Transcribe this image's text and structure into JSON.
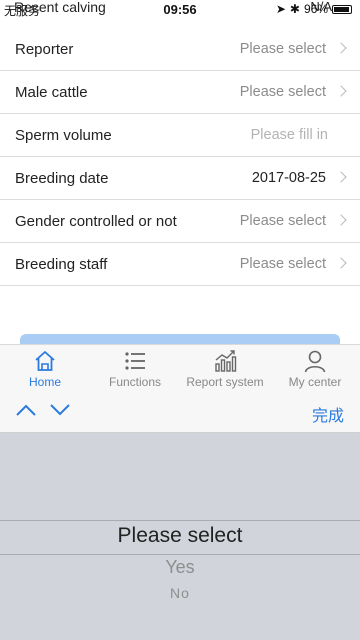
{
  "status_bar": {
    "carrier": "无服务",
    "title_overlap": "Recent calving",
    "time": "09:56",
    "na": "N/A",
    "battery": "96%"
  },
  "form": {
    "rows": [
      {
        "label": "Reporter",
        "value": "Please select",
        "kind": "select"
      },
      {
        "label": "Male cattle",
        "value": "Please select",
        "kind": "select"
      },
      {
        "label": "Sperm volume",
        "value": "Please fill in",
        "kind": "input"
      },
      {
        "label": "Breeding date",
        "value": "2017-08-25",
        "kind": "filled"
      },
      {
        "label": "Gender controlled or not",
        "value": "Please select",
        "kind": "select"
      },
      {
        "label": "Breeding staff",
        "value": "Please select",
        "kind": "select"
      }
    ]
  },
  "tabs": [
    {
      "label": "Home",
      "icon": "home-icon",
      "active": true
    },
    {
      "label": "Functions",
      "icon": "list-icon",
      "active": false
    },
    {
      "label": "Report system",
      "icon": "chart-icon",
      "active": false
    },
    {
      "label": "My center",
      "icon": "user-icon",
      "active": false
    }
  ],
  "picker": {
    "done_label": "完成",
    "options": [
      "Please select",
      "Yes",
      "No"
    ],
    "selected": "Please select"
  },
  "colors": {
    "accent": "#2b7ae0",
    "picker_bg": "#d1d5db",
    "submit_button": "#a9cdf4"
  }
}
